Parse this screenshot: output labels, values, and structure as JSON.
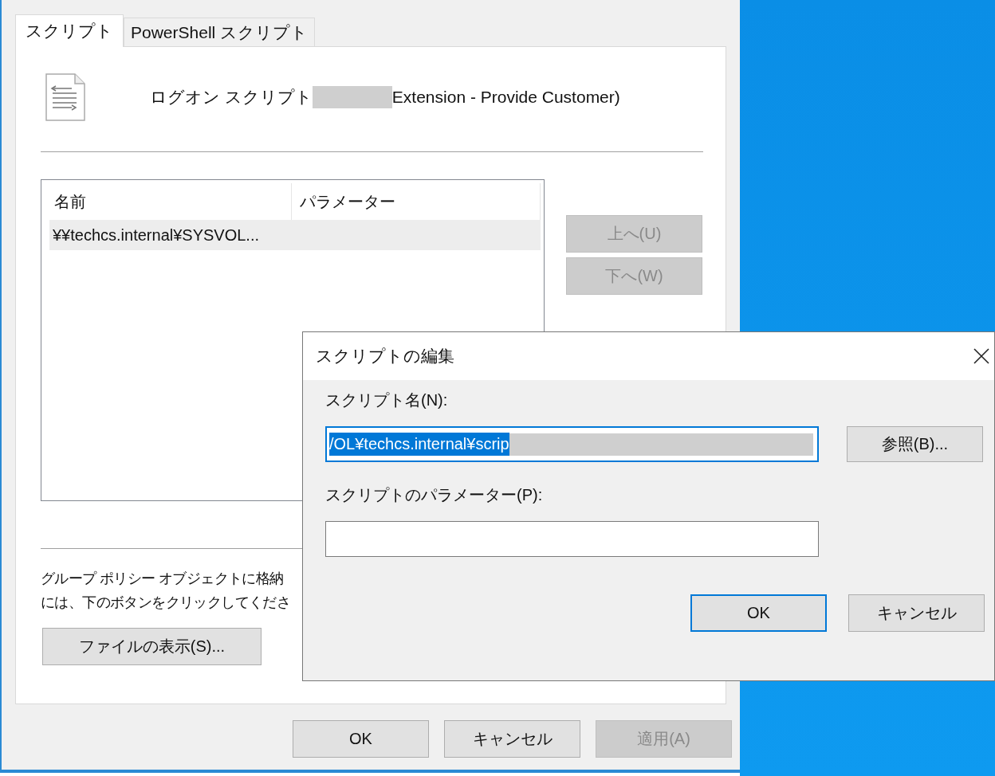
{
  "window": {
    "tabs": [
      {
        "label": "スクリプト",
        "selected": true
      },
      {
        "label": "PowerShell スクリプト",
        "selected": false
      }
    ],
    "header": {
      "prefix": "ログオン スクリプト",
      "redacted": true,
      "suffix": "Extension - Provide Customer)"
    },
    "list": {
      "columns": [
        "名前",
        "パラメーター"
      ],
      "rows": [
        {
          "name": "¥¥techcs.internal¥SYSVOL...",
          "selected": true
        }
      ]
    },
    "side_buttons": [
      {
        "label": "上へ(U)",
        "disabled": true
      },
      {
        "label": "下へ(W)",
        "disabled": true
      }
    ],
    "description": [
      "グループ ポリシー オブジェクトに格納",
      "には、下のボタンをクリックしてくださ"
    ],
    "show_files_button": "ファイルの表示(S)...",
    "buttons": [
      {
        "label": "OK",
        "disabled": false
      },
      {
        "label": "キャンセル",
        "disabled": false
      },
      {
        "label": "適用(A)",
        "disabled": true
      }
    ]
  },
  "dialog": {
    "title": "スクリプトの編集",
    "script_name": {
      "label": "スクリプト名(N):",
      "value": "/OL¥techcs.internal¥scrip",
      "text_selected": true,
      "redacted": true
    },
    "browse_button": "参照(B)...",
    "parameters": {
      "label": "スクリプトのパラメーター(P):"
    },
    "buttons": [
      {
        "label": "OK",
        "default": true
      },
      {
        "label": "キャンセル",
        "default": false
      }
    ]
  }
}
